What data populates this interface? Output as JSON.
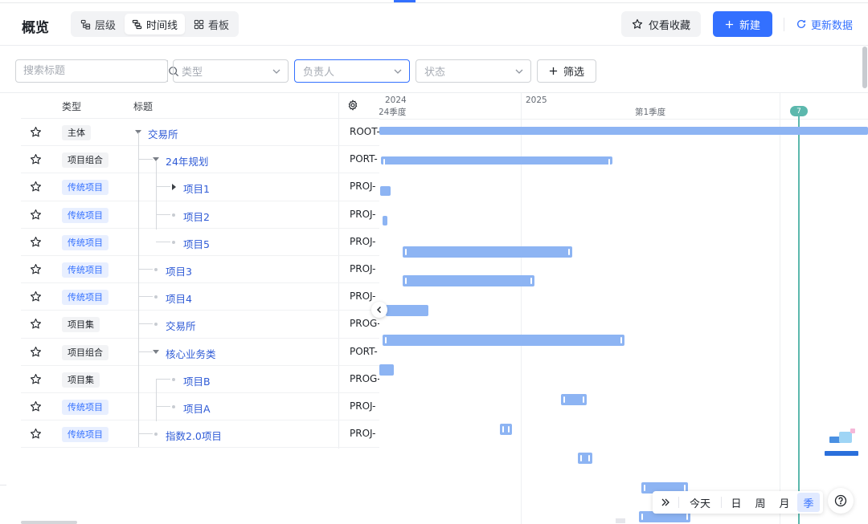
{
  "header": {
    "title": "概览",
    "views": [
      {
        "label": "层级",
        "icon": "hierarchy-icon",
        "active": false
      },
      {
        "label": "时间线",
        "icon": "timeline-icon",
        "active": true
      },
      {
        "label": "看板",
        "icon": "board-icon",
        "active": false
      }
    ],
    "favorites_label": "仅看收藏",
    "new_label": "新建",
    "refresh_label": "更新数据"
  },
  "filters": {
    "search_placeholder": "搜索标题",
    "type_placeholder": "类型",
    "owner_placeholder": "负责人",
    "status_placeholder": "状态",
    "filter_label": "筛选"
  },
  "table": {
    "headers": {
      "type": "类型",
      "title": "标题"
    },
    "rows": [
      {
        "type": "主体",
        "style": "gray",
        "title": "交易所",
        "code": "ROOT-",
        "level": 0,
        "caret": "down"
      },
      {
        "type": "项目组合",
        "style": "gray",
        "title": "24年规划",
        "code": "PORT-",
        "level": 1,
        "caret": "down"
      },
      {
        "type": "传统项目",
        "style": "blue",
        "title": "项目1",
        "code": "PROJ-",
        "level": 2,
        "caret": "right"
      },
      {
        "type": "传统项目",
        "style": "blue",
        "title": "项目2",
        "code": "PROJ-",
        "level": 2,
        "caret": "dot"
      },
      {
        "type": "传统项目",
        "style": "blue",
        "title": "项目5",
        "code": "PROJ-",
        "level": 2,
        "caret": "dot"
      },
      {
        "type": "传统项目",
        "style": "blue",
        "title": "项目3",
        "code": "PROJ-",
        "level": 1,
        "caret": "dot"
      },
      {
        "type": "传统项目",
        "style": "blue",
        "title": "项目4",
        "code": "PROJ-",
        "level": 1,
        "caret": "dot"
      },
      {
        "type": "项目集",
        "style": "gray",
        "title": "交易所",
        "code": "PROG-",
        "level": 1,
        "caret": "dot"
      },
      {
        "type": "项目组合",
        "style": "gray",
        "title": "核心业务类",
        "code": "PORT-",
        "level": 1,
        "caret": "down"
      },
      {
        "type": "项目集",
        "style": "gray",
        "title": "项目B",
        "code": "PROG-",
        "level": 2,
        "caret": "dot"
      },
      {
        "type": "传统项目",
        "style": "blue",
        "title": "项目A",
        "code": "PROJ-",
        "level": 2,
        "caret": "dot"
      },
      {
        "type": "传统项目",
        "style": "blue",
        "title": "指数2.0项目",
        "code": "PROJ-",
        "level": 1,
        "caret": "dot"
      }
    ]
  },
  "gantt": {
    "years": [
      "2024",
      "2025"
    ],
    "quarters": [
      "24季度",
      "第1季度"
    ],
    "today_badge": "7"
  },
  "zoom": {
    "today_label": "今天",
    "units": [
      "日",
      "周",
      "月",
      "季"
    ],
    "active_unit": "季"
  },
  "colors": {
    "accent": "#3370ff",
    "bar": "#8db4f3",
    "today": "#5cb8ad"
  }
}
